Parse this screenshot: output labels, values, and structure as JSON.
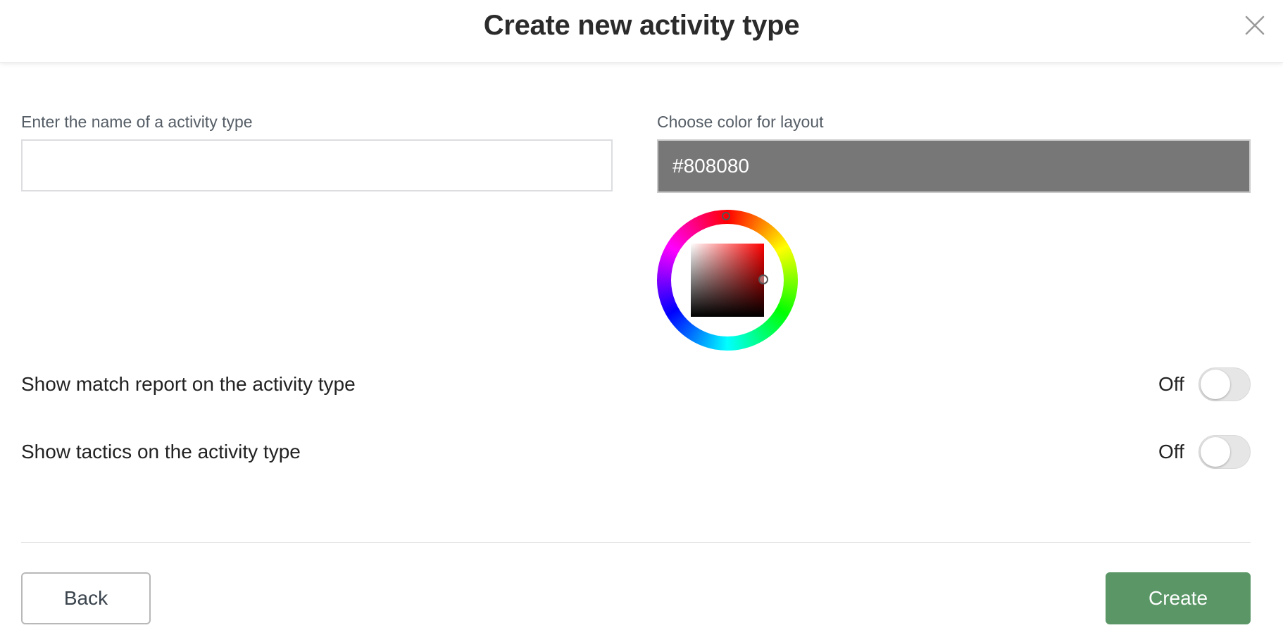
{
  "header": {
    "title": "Create new activity type",
    "close_icon": "close-icon"
  },
  "form": {
    "name_label": "Enter the name of a activity type",
    "name_value": "",
    "color_label": "Choose color for layout",
    "color_value": "#808080",
    "color_swatch": "#777777",
    "picker_hue": "#ff0000"
  },
  "settings": [
    {
      "label": "Show match report on the activity type",
      "state_text": "Off",
      "on": false
    },
    {
      "label": "Show tactics on the activity type",
      "state_text": "Off",
      "on": false
    }
  ],
  "footer": {
    "back_label": "Back",
    "create_label": "Create",
    "create_color": "#5a9666"
  }
}
